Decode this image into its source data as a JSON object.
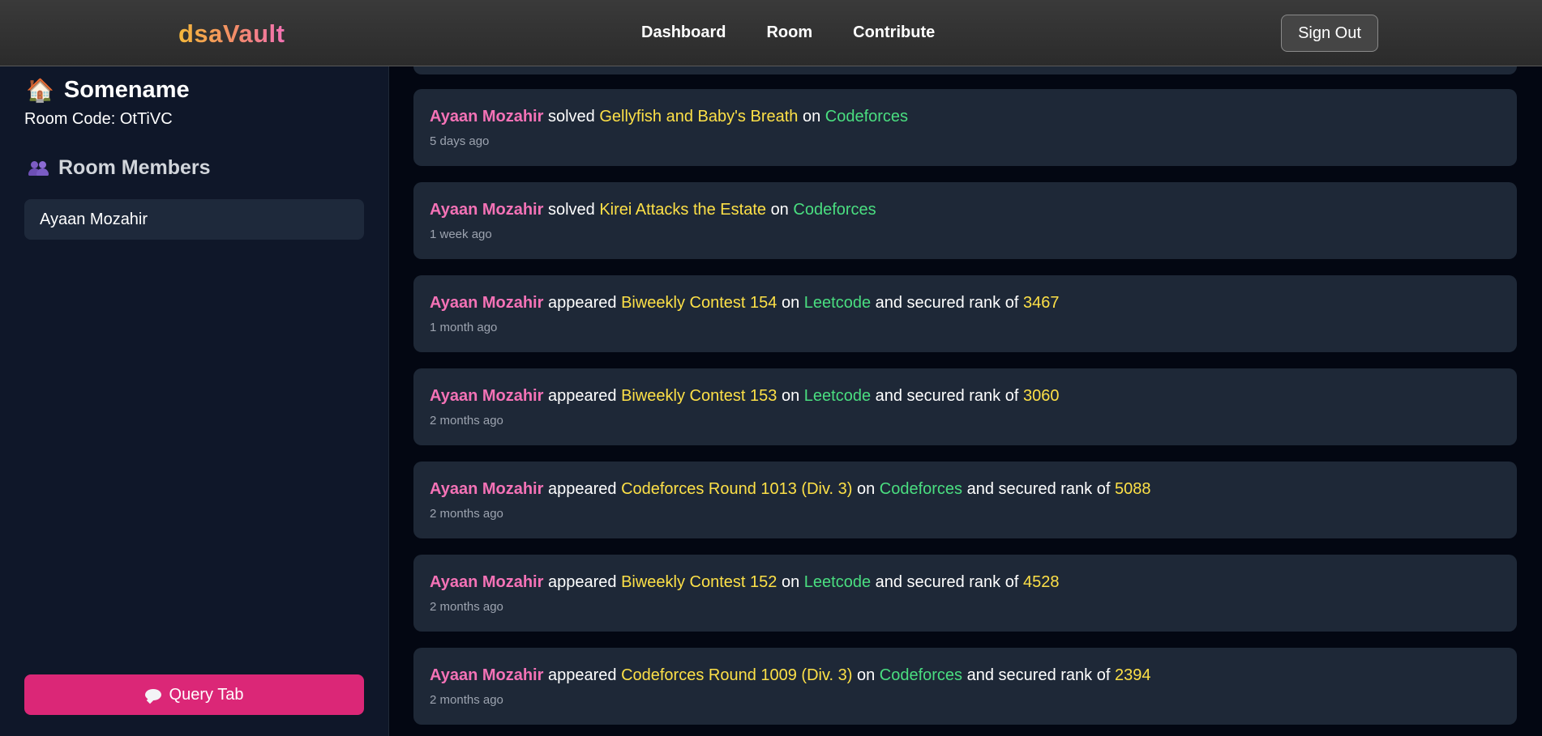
{
  "brand": "dsaVault",
  "nav": {
    "links": [
      "Dashboard",
      "Room",
      "Contribute"
    ],
    "signout_label": "Sign Out"
  },
  "sidebar": {
    "room_icon": "house-icon",
    "room_name": "Somename",
    "room_code": "Room Code: OtTiVC",
    "members_icon": "users-icon",
    "members_title": "Room Members",
    "members": [
      "Ayaan Mozahir"
    ],
    "query_icon": "speech-bubble-icon",
    "query_label": "Query Tab"
  },
  "feed": [
    {
      "user": "Ayaan Mozahir",
      "verb": "solved",
      "item": "Gellyfish and Baby's Breath",
      "on": "on",
      "platform": "Codeforces",
      "time": "5 days ago"
    },
    {
      "user": "Ayaan Mozahir",
      "verb": "solved",
      "item": "Kirei Attacks the Estate",
      "on": "on",
      "platform": "Codeforces",
      "time": "1 week ago"
    },
    {
      "user": "Ayaan Mozahir",
      "verb": "appeared",
      "item": "Biweekly Contest 154",
      "on": "on",
      "platform": "Leetcode",
      "rank_text": "and secured rank of",
      "rank": "3467",
      "time": "1 month ago"
    },
    {
      "user": "Ayaan Mozahir",
      "verb": "appeared",
      "item": "Biweekly Contest 153",
      "on": "on",
      "platform": "Leetcode",
      "rank_text": "and secured rank of",
      "rank": "3060",
      "time": "2 months ago"
    },
    {
      "user": "Ayaan Mozahir",
      "verb": "appeared",
      "item": "Codeforces Round 1013 (Div. 3)",
      "on": "on",
      "platform": "Codeforces",
      "rank_text": "and secured rank of",
      "rank": "5088",
      "time": "2 months ago"
    },
    {
      "user": "Ayaan Mozahir",
      "verb": "appeared",
      "item": "Biweekly Contest 152",
      "on": "on",
      "platform": "Leetcode",
      "rank_text": "and secured rank of",
      "rank": "4528",
      "time": "2 months ago"
    },
    {
      "user": "Ayaan Mozahir",
      "verb": "appeared",
      "item": "Codeforces Round 1009 (Div. 3)",
      "on": "on",
      "platform": "Codeforces",
      "rank_text": "and secured rank of",
      "rank": "2394",
      "time": "2 months ago"
    }
  ],
  "colors": {
    "user": "#f472b6",
    "highlight": "#fde047",
    "platform": "#4ade80",
    "accent_button": "#db2777"
  }
}
